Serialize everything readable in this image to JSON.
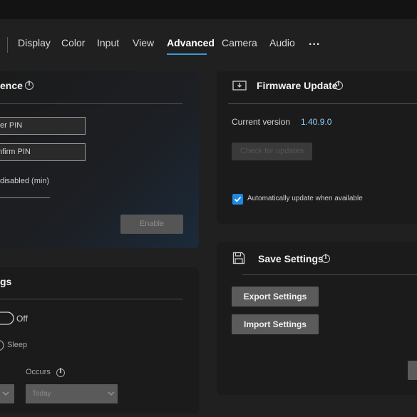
{
  "nav": {
    "tabs": [
      {
        "label": "Display"
      },
      {
        "label": "Color"
      },
      {
        "label": "Input"
      },
      {
        "label": "View"
      },
      {
        "label": "Advanced",
        "active": true
      },
      {
        "label": "Camera"
      },
      {
        "label": "Audio"
      }
    ],
    "more_label": "..."
  },
  "pin_panel": {
    "title": "ence",
    "enter_pin_placeholder": "ter PIN",
    "confirm_pin_placeholder": "nfirm PIN",
    "disabled_label": "disabled (min)",
    "enable_label": "Enable"
  },
  "firmware": {
    "title": "Firmware Update",
    "icon": "firmware-icon",
    "current_version_label": "Current version",
    "current_version_value": "1.40.9.0",
    "check_label": "Check for updates",
    "auto_update_label": "Automatically update when available",
    "auto_update_checked": true
  },
  "save_settings": {
    "title": "Save Settings",
    "icon": "save-icon",
    "export_label": "Export Settings",
    "import_label": "Import Settings"
  },
  "schedule_panel": {
    "title": "gs",
    "toggle_label": "Off",
    "sleep_label": "Sleep",
    "occurs_label": "Occurs",
    "occurs_value": "Today"
  },
  "colors": {
    "accent": "#3a9ad9",
    "version_text": "#8fd0ff",
    "checkbox": "#1e88e5"
  }
}
